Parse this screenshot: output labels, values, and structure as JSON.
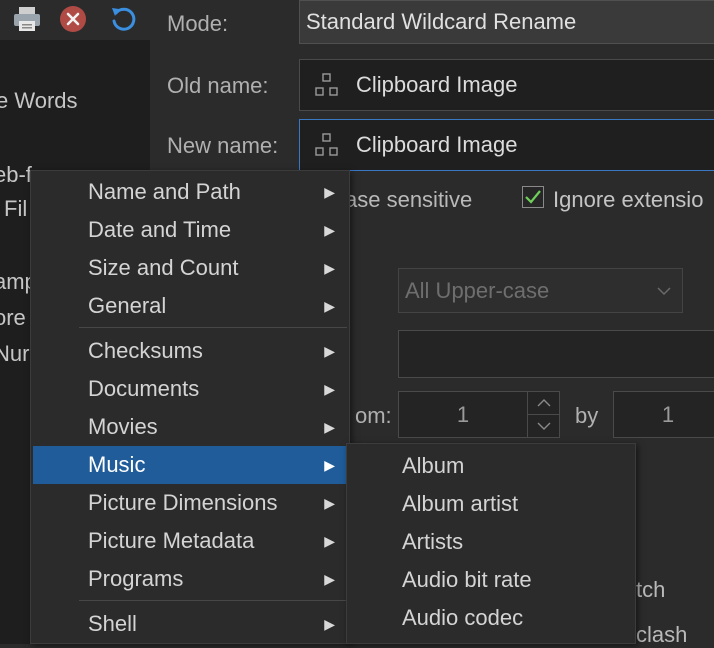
{
  "toolbar": {
    "icons": [
      "printer-icon",
      "close-icon",
      "undo-icon"
    ],
    "colors": {
      "close": "#b04a44",
      "undo": "#3b8fe0"
    }
  },
  "left_pane": {
    "items": [
      "e Words",
      "eb-f",
      "Fil",
      "amp",
      "ore",
      "Nur"
    ]
  },
  "form": {
    "mode_label": "Mode:",
    "mode_value": "Standard Wildcard Rename",
    "old_name_label": "Old name:",
    "old_name_value": "Clipboard Image",
    "new_name_label": "New name:",
    "new_name_value": "Clipboard Image",
    "case_sensitive_label": "ase sensitive",
    "ignore_extension_label": "Ignore extensio",
    "ignore_extension_checked": true,
    "case_select_value": "All Upper-case",
    "from_label": "om:",
    "from_value": "1",
    "by_label": "by",
    "by_value": "1",
    "right_fragment_1": "tch",
    "right_fragment_2": "clash"
  },
  "context_menu": {
    "items": [
      {
        "label": "Name and Path",
        "submenu": true
      },
      {
        "label": "Date and Time",
        "submenu": true
      },
      {
        "label": "Size and Count",
        "submenu": true
      },
      {
        "label": "General",
        "submenu": true
      },
      {
        "label": "Checksums",
        "submenu": true
      },
      {
        "label": "Documents",
        "submenu": true
      },
      {
        "label": "Movies",
        "submenu": true
      },
      {
        "label": "Music",
        "submenu": true,
        "selected": true
      },
      {
        "label": "Picture Dimensions",
        "submenu": true
      },
      {
        "label": "Picture Metadata",
        "submenu": true
      },
      {
        "label": "Programs",
        "submenu": true
      },
      {
        "label": "Shell",
        "submenu": true
      }
    ],
    "selected_color": "#1f5c99"
  },
  "music_submenu": {
    "items": [
      "Album",
      "Album artist",
      "Artists",
      "Audio bit rate",
      "Audio codec"
    ]
  }
}
